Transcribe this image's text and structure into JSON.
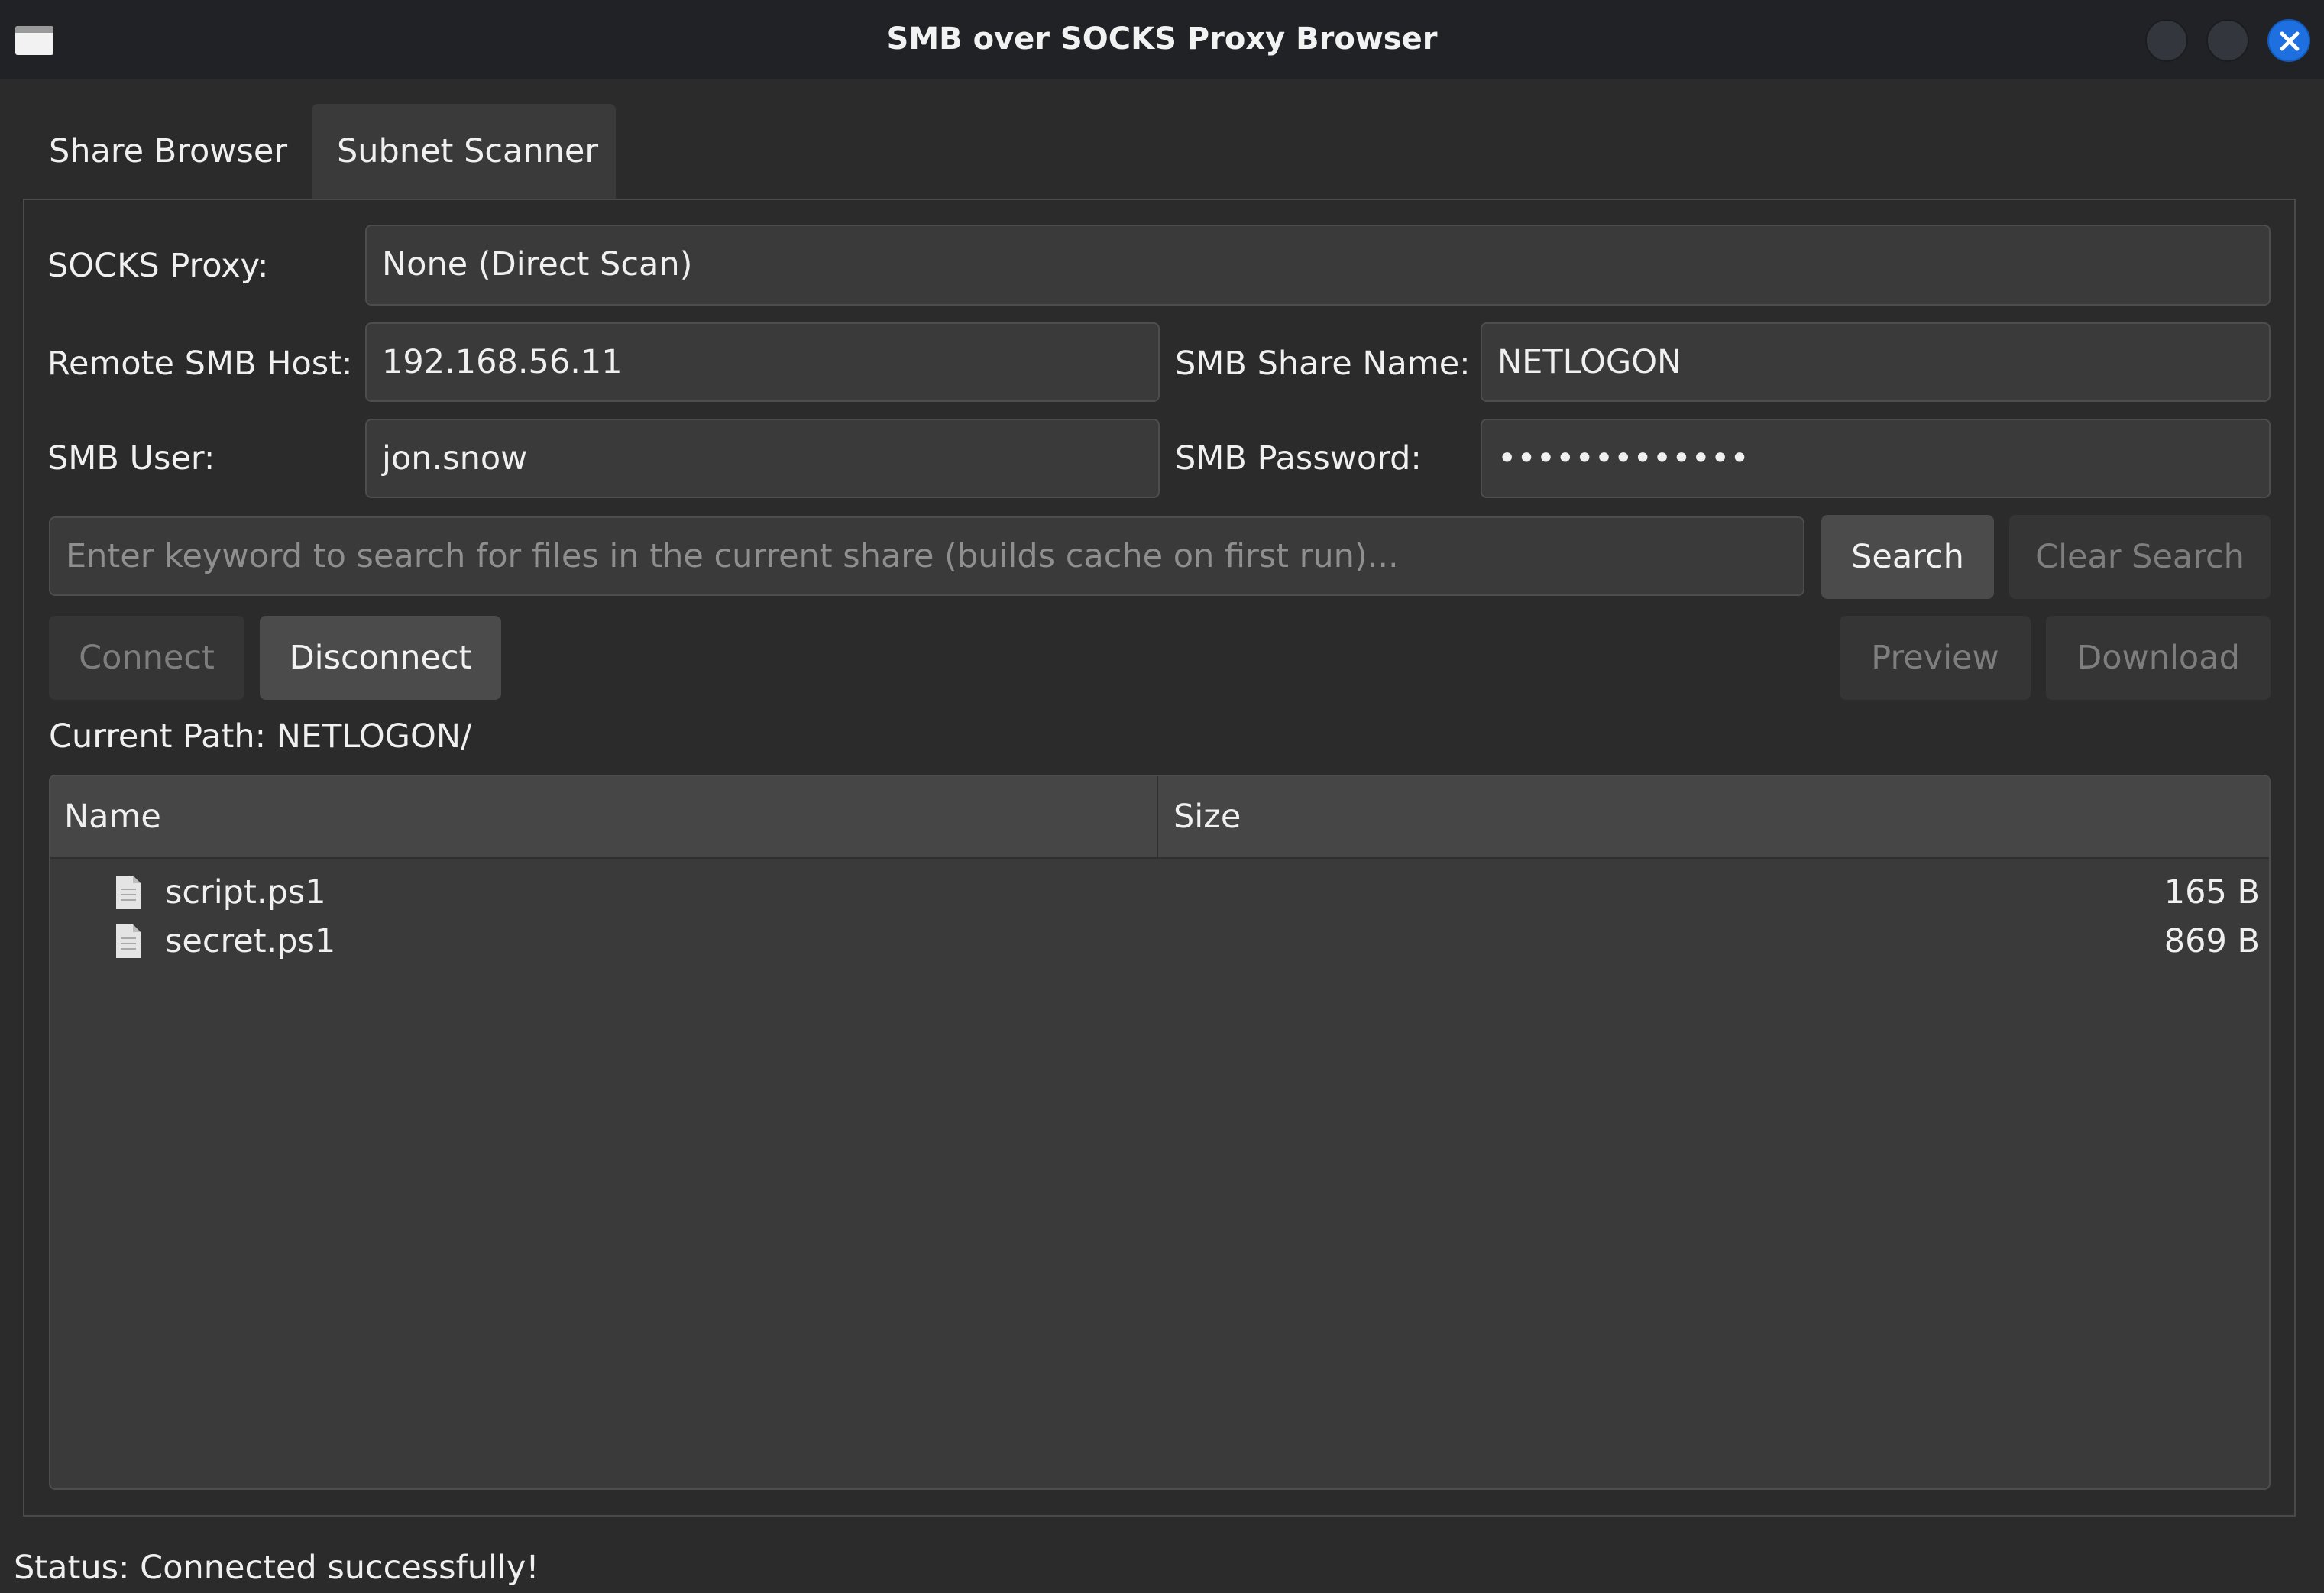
{
  "window": {
    "title": "SMB over SOCKS Proxy Browser",
    "accent_color": "#1e6fe0"
  },
  "tabs": [
    {
      "label": "Share Browser",
      "selected": false
    },
    {
      "label": "Subnet Scanner",
      "selected": true
    }
  ],
  "form": {
    "socks_proxy_label": "SOCKS Proxy:",
    "socks_proxy_value": "None (Direct Scan)",
    "remote_host_label": "Remote SMB Host:",
    "remote_host_value": "192.168.56.11",
    "share_name_label": "SMB Share Name:",
    "share_name_value": "NETLOGON",
    "user_label": "SMB User:",
    "user_value": "jon.snow",
    "password_label": "SMB Password:",
    "password_value": "•••••••••••••"
  },
  "search": {
    "placeholder": "Enter keyword to search for files in the current share (builds cache on first run)...",
    "search_label": "Search",
    "clear_label": "Clear Search"
  },
  "actions": {
    "connect_label": "Connect",
    "disconnect_label": "Disconnect",
    "preview_label": "Preview",
    "download_label": "Download"
  },
  "current_path": "Current Path: NETLOGON/",
  "table": {
    "columns": [
      "Name",
      "Size"
    ],
    "rows": [
      {
        "icon": "file-icon",
        "name": "script.ps1",
        "size": "165 B"
      },
      {
        "icon": "file-icon",
        "name": "secret.ps1",
        "size": "869 B"
      }
    ]
  },
  "status": "Status: Connected successfully!"
}
